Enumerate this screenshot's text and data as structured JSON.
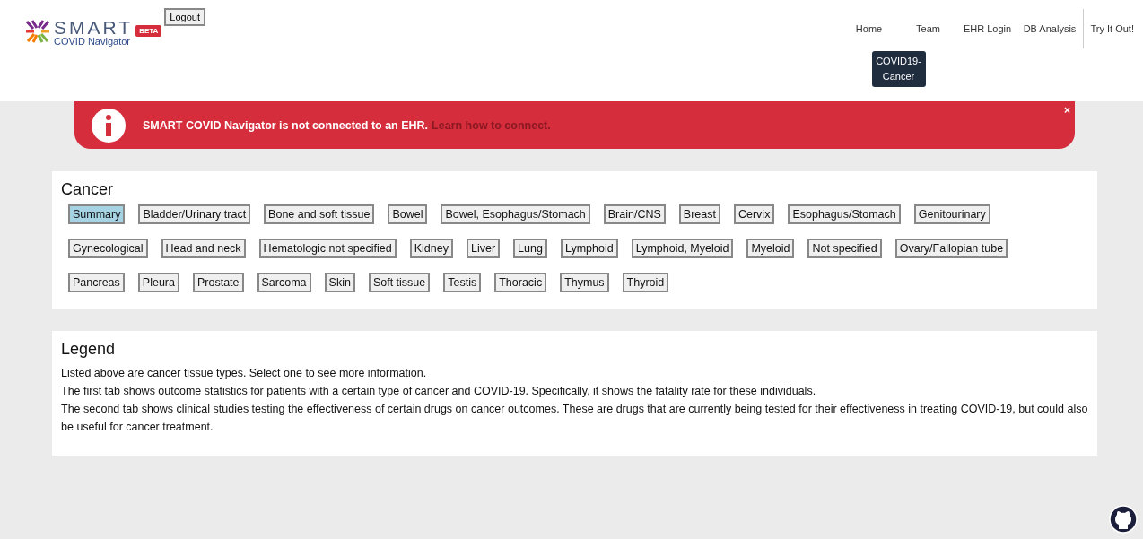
{
  "header": {
    "logo": {
      "wordmark": "SMART",
      "subtitle": "COVID Navigator",
      "badge": "BETA"
    },
    "logout_button": "Logout",
    "nav": [
      {
        "label": "Home",
        "selected": false
      },
      {
        "label": "Team",
        "selected": false
      },
      {
        "label": "EHR Login",
        "selected": false
      },
      {
        "label": "DB Analysis",
        "selected": false
      },
      {
        "label": "Try It Out!",
        "selected": false
      }
    ],
    "dropdown_item": "COVID19-Cancer"
  },
  "alert": {
    "message": "SMART COVID Navigator is not connected to an EHR.",
    "link": "Learn how to connect.",
    "close": "×"
  },
  "cancer": {
    "title": "Cancer",
    "tag_rows": [
      [
        {
          "label": "Summary",
          "selected": true
        },
        {
          "label": "Bladder/Urinary tract",
          "selected": false
        },
        {
          "label": "Bone and soft tissue",
          "selected": false
        },
        {
          "label": "Bowel",
          "selected": false
        },
        {
          "label": "Bowel, Esophagus/Stomach",
          "selected": false
        },
        {
          "label": "Brain/CNS",
          "selected": false
        },
        {
          "label": "Breast",
          "selected": false
        },
        {
          "label": "Cervix",
          "selected": false
        },
        {
          "label": "Esophagus/Stomach",
          "selected": false
        },
        {
          "label": "Genitourinary",
          "selected": false
        }
      ],
      [
        {
          "label": "Gynecological",
          "selected": false
        },
        {
          "label": "Head and neck",
          "selected": false
        },
        {
          "label": "Hematologic not specified",
          "selected": false
        },
        {
          "label": "Kidney",
          "selected": false
        },
        {
          "label": "Liver",
          "selected": false
        },
        {
          "label": "Lung",
          "selected": false
        },
        {
          "label": "Lymphoid",
          "selected": false
        },
        {
          "label": "Lymphoid, Myeloid",
          "selected": false
        },
        {
          "label": "Myeloid",
          "selected": false
        },
        {
          "label": "Not specified",
          "selected": false
        },
        {
          "label": "Ovary/Fallopian tube",
          "selected": false
        }
      ],
      [
        {
          "label": "Pancreas",
          "selected": false
        },
        {
          "label": "Pleura",
          "selected": false
        },
        {
          "label": "Prostate",
          "selected": false
        },
        {
          "label": "Sarcoma",
          "selected": false
        },
        {
          "label": "Skin",
          "selected": false
        },
        {
          "label": "Soft tissue",
          "selected": false
        },
        {
          "label": "Testis",
          "selected": false
        },
        {
          "label": "Thoracic",
          "selected": false
        },
        {
          "label": "Thymus",
          "selected": false
        },
        {
          "label": "Thyroid",
          "selected": false
        }
      ]
    ]
  },
  "legend": {
    "title": "Legend",
    "paragraphs": [
      "Listed above are cancer tissue types. Select one to see more information.",
      "The first tab shows outcome statistics for patients with a certain type of cancer and COVID-19. Specifically, it shows the fatality rate for these individuals.",
      "The second tab shows clinical studies testing the effectiveness of certain drugs on cancer outcomes. These are drugs that are currently being tested for their effectiveness in treating COVID-19, but could also be useful for cancer treatment."
    ]
  }
}
